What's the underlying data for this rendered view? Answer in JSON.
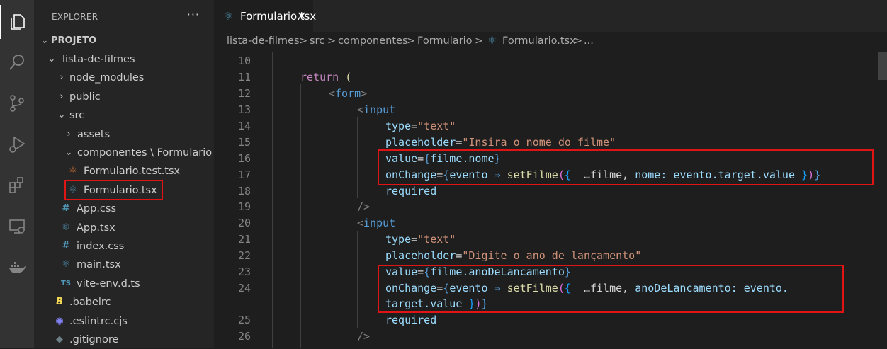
{
  "activity_bar": {
    "icons": [
      "files-icon",
      "search-icon",
      "source-control-icon",
      "run-debug-icon",
      "extensions-icon",
      "remote-explorer-icon",
      "docker-icon"
    ]
  },
  "explorer": {
    "title": "EXPLORER",
    "more": "···",
    "project": "PROJETO",
    "items": [
      {
        "label": "lista-de-filmes"
      },
      {
        "label": "node_modules"
      },
      {
        "label": "public"
      },
      {
        "label": "src"
      },
      {
        "label": "assets"
      },
      {
        "label": "componentes \\ Formulario"
      },
      {
        "label": "Formulario.test.tsx"
      },
      {
        "label": "Formulario.tsx"
      },
      {
        "label": "App.css"
      },
      {
        "label": "App.tsx"
      },
      {
        "label": "index.css"
      },
      {
        "label": "main.tsx"
      },
      {
        "label": "vite-env.d.ts"
      },
      {
        "label": ".babelrc"
      },
      {
        "label": ".eslintrc.cjs"
      },
      {
        "label": ".gitignore"
      }
    ],
    "icons": {
      "hash": "#",
      "ts": "TS",
      "babel": "B"
    }
  },
  "tab": {
    "label": "Formulario.tsx",
    "close": "✕"
  },
  "breadcrumb": {
    "items": [
      "lista-de-filmes",
      "src",
      "componentes",
      "Formulario",
      "Formulario.tsx",
      "..."
    ],
    "sep": ">"
  },
  "editor": {
    "line_numbers": [
      "10",
      "11",
      "12",
      "13",
      "14",
      "15",
      "16",
      "17",
      "18",
      "19",
      "20",
      "21",
      "22",
      "23",
      "24",
      "25",
      "26"
    ],
    "tokens": {
      "return": "return",
      "lparen": "(",
      "form_open": "<",
      "form": "form",
      "gt": ">",
      "input": "input",
      "type": "type",
      "eq": "=",
      "text_str": "\"text\"",
      "placeholder": "placeholder",
      "ph1": "\"Insira o nome do filme\"",
      "ph2": "\"Digite o ano de lançamento\"",
      "value": "value",
      "lb": "{",
      "rb": "}",
      "filme_nome": "filme.nome",
      "filme_ano": "filme.anoDeLancamento",
      "onChange": "onChange",
      "evento": "evento",
      "arrow": "⇒",
      "setFilme": "setFilme",
      "lp": "(",
      "rp": ")",
      "spread": " …filme,",
      "nome": " nome:",
      "anoDeLancamento": " anoDeLancamento:",
      "evento_target": " evento.target.value ",
      "evento_dot": " evento.",
      "target_value": "target.value ",
      "required": "required",
      "selfclose": "/>"
    }
  }
}
